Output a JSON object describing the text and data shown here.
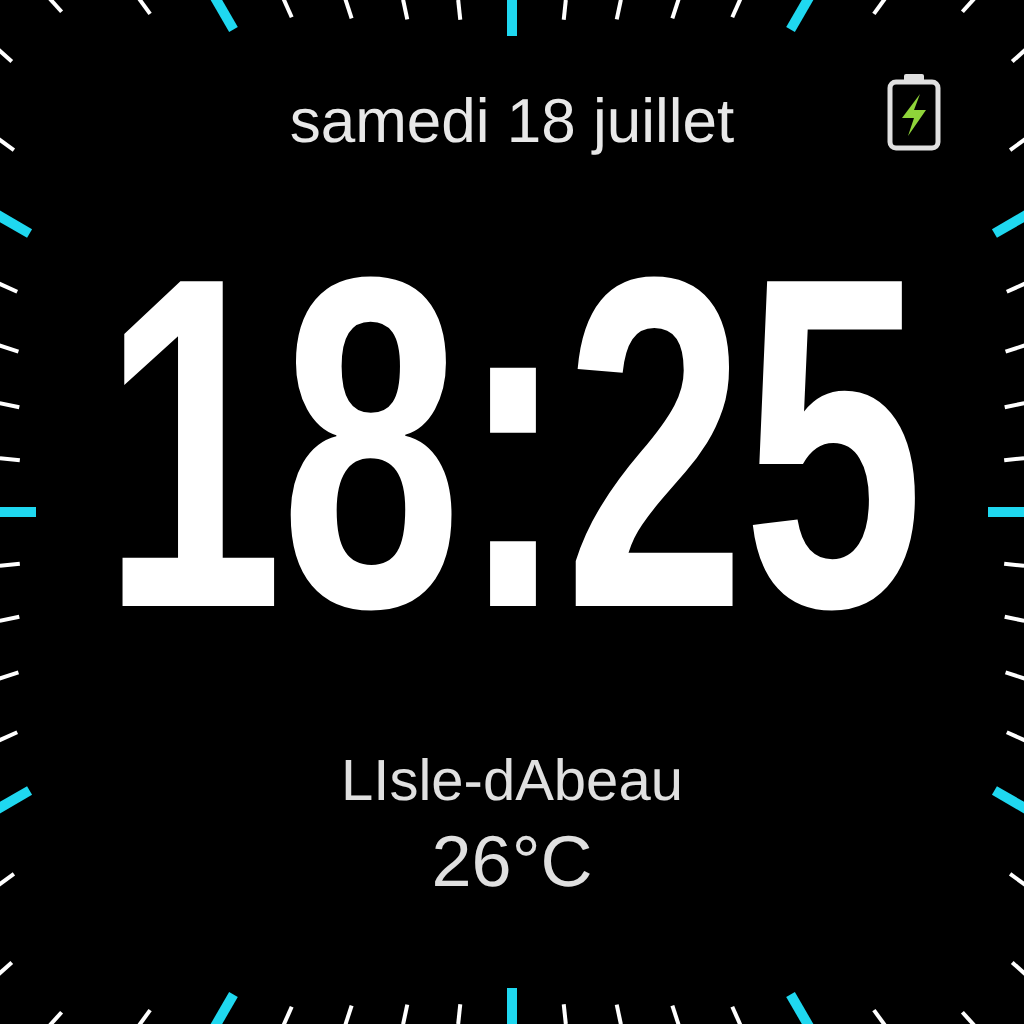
{
  "date": "samedi 18 juillet",
  "battery": {
    "charging": true
  },
  "time": "18:25",
  "location": "LIsle-dAbeau",
  "temperature": "26°C"
}
